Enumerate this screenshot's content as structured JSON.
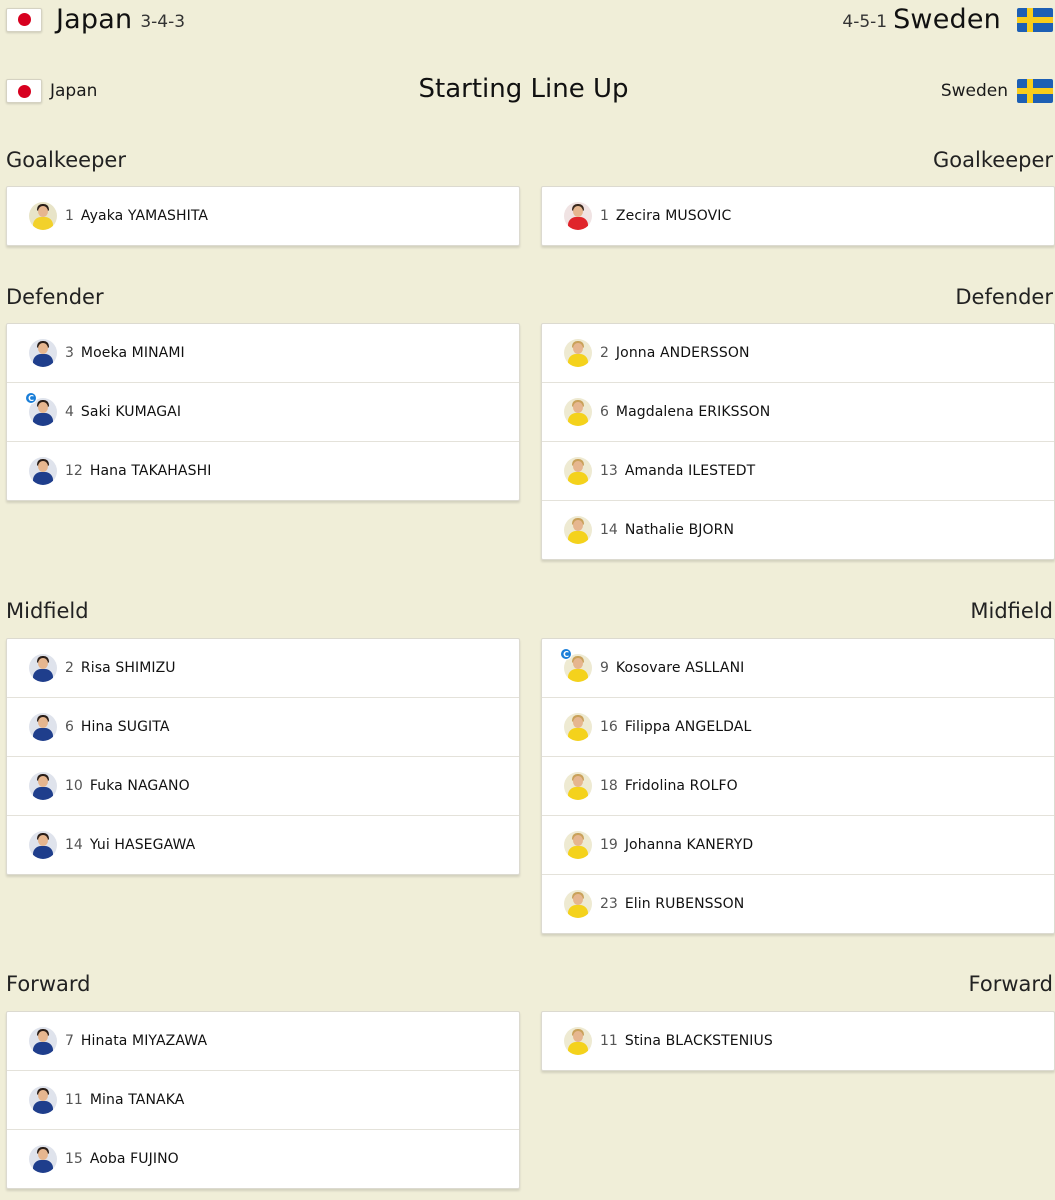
{
  "match": {
    "home": {
      "name": "Japan",
      "formation": "3-4-3",
      "flag": "japan-flag"
    },
    "away": {
      "name": "Sweden",
      "formation": "4-5-1",
      "flag": "sweden-flag"
    }
  },
  "lineup": {
    "title": "Starting Line Up",
    "home_label": "Japan",
    "away_label": "Sweden"
  },
  "sections": {
    "goalkeeper": "Goalkeeper",
    "defender": "Defender",
    "midfield": "Midfield",
    "forward": "Forward"
  },
  "captain_icon": "C",
  "home_players": {
    "goalkeeper": [
      {
        "number": "1",
        "name": "Ayaka YAMASHITA",
        "kit": "jp-gk"
      }
    ],
    "defender": [
      {
        "number": "3",
        "name": "Moeka MINAMI",
        "kit": "jp"
      },
      {
        "number": "4",
        "name": "Saki KUMAGAI",
        "kit": "jp",
        "captain": true
      },
      {
        "number": "12",
        "name": "Hana TAKAHASHI",
        "kit": "jp"
      }
    ],
    "midfield": [
      {
        "number": "2",
        "name": "Risa SHIMIZU",
        "kit": "jp"
      },
      {
        "number": "6",
        "name": "Hina SUGITA",
        "kit": "jp"
      },
      {
        "number": "10",
        "name": "Fuka NAGANO",
        "kit": "jp"
      },
      {
        "number": "14",
        "name": "Yui HASEGAWA",
        "kit": "jp"
      }
    ],
    "forward": [
      {
        "number": "7",
        "name": "Hinata MIYAZAWA",
        "kit": "jp"
      },
      {
        "number": "11",
        "name": "Mina TANAKA",
        "kit": "jp"
      },
      {
        "number": "15",
        "name": "Aoba FUJINO",
        "kit": "jp"
      }
    ]
  },
  "away_players": {
    "goalkeeper": [
      {
        "number": "1",
        "name": "Zecira MUSOVIC",
        "kit": "se-gk"
      }
    ],
    "defender": [
      {
        "number": "2",
        "name": "Jonna ANDERSSON",
        "kit": "se"
      },
      {
        "number": "6",
        "name": "Magdalena ERIKSSON",
        "kit": "se"
      },
      {
        "number": "13",
        "name": "Amanda ILESTEDT",
        "kit": "se"
      },
      {
        "number": "14",
        "name": "Nathalie BJORN",
        "kit": "se"
      }
    ],
    "midfield": [
      {
        "number": "9",
        "name": "Kosovare ASLLANI",
        "kit": "se",
        "captain": true
      },
      {
        "number": "16",
        "name": "Filippa ANGELDAL",
        "kit": "se"
      },
      {
        "number": "18",
        "name": "Fridolina ROLFO",
        "kit": "se"
      },
      {
        "number": "19",
        "name": "Johanna KANERYD",
        "kit": "se"
      },
      {
        "number": "23",
        "name": "Elin RUBENSSON",
        "kit": "se"
      }
    ],
    "forward": [
      {
        "number": "11",
        "name": "Stina BLACKSTENIUS",
        "kit": "se"
      }
    ]
  }
}
